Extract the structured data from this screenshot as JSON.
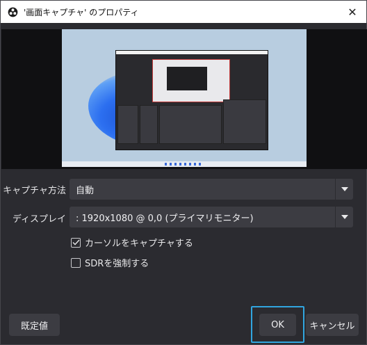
{
  "window": {
    "title": "'画面キャプチャ' のプロパティ",
    "close_glyph": "✕"
  },
  "form": {
    "capture_method": {
      "label": "キャプチャ方法",
      "value": "自動"
    },
    "display": {
      "label": "ディスプレイ",
      "value": ": 1920x1080 @ 0,0 (プライマリモニター)"
    },
    "capture_cursor": {
      "label": "カーソルをキャプチャする",
      "checked": true
    },
    "force_sdr": {
      "label": "SDRを強制する",
      "checked": false
    }
  },
  "buttons": {
    "defaults": "既定値",
    "ok": "OK",
    "cancel": "キャンセル"
  },
  "colors": {
    "accent": "#31a6e0",
    "dialog_bg": "#2b2b30",
    "control_bg": "#3c3c42"
  }
}
